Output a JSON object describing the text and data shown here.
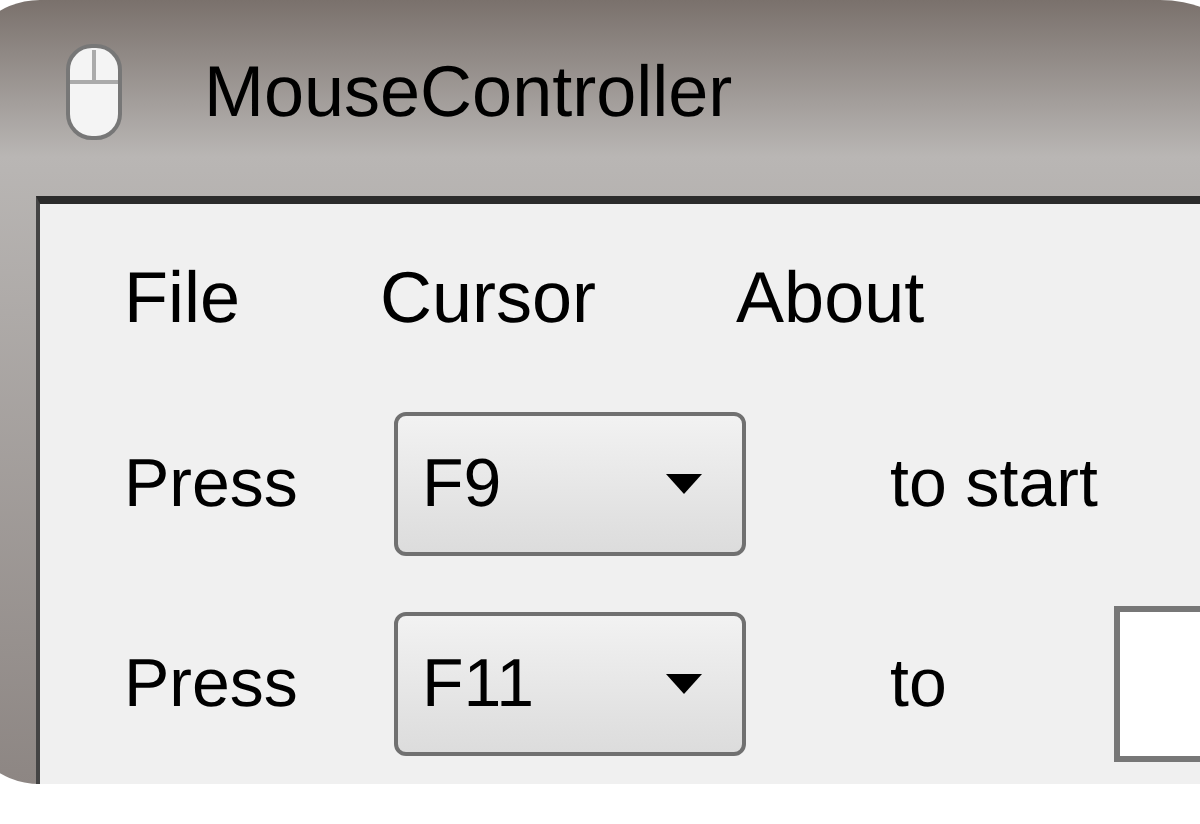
{
  "window": {
    "title": "MouseController"
  },
  "menu": [
    {
      "label": "File"
    },
    {
      "label": "Cursor"
    },
    {
      "label": "About"
    }
  ],
  "rows": [
    {
      "label": "Press",
      "key": "F9",
      "action": "to start"
    },
    {
      "label": "Press",
      "key": "F11",
      "action": "to",
      "has_field": true
    }
  ]
}
